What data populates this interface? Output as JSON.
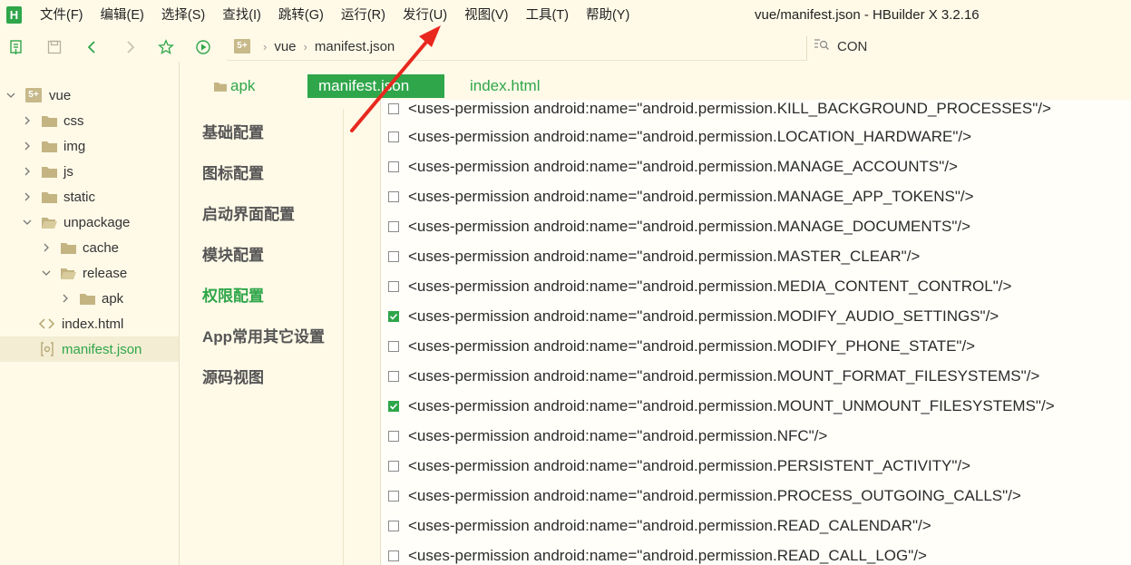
{
  "app": {
    "logo": "H",
    "window_title": "vue/manifest.json - HBuilder X 3.2.16"
  },
  "menu": [
    "文件(F)",
    "编辑(E)",
    "选择(S)",
    "查找(I)",
    "跳转(G)",
    "运行(R)",
    "发行(U)",
    "视图(V)",
    "工具(T)",
    "帮助(Y)"
  ],
  "toolbar": {
    "icons": [
      "new-file-icon",
      "save-icon",
      "back-icon",
      "forward-icon",
      "star-icon",
      "run-icon"
    ],
    "breadcrumb": {
      "logo": "5+",
      "items": [
        "vue",
        "manifest.json"
      ]
    },
    "search": {
      "value": "CON"
    }
  },
  "sidebar": {
    "tree": [
      {
        "label": "vue",
        "depth": 0,
        "expanded": true,
        "type": "project"
      },
      {
        "label": "css",
        "depth": 1,
        "expanded": false,
        "type": "folder"
      },
      {
        "label": "img",
        "depth": 1,
        "expanded": false,
        "type": "folder"
      },
      {
        "label": "js",
        "depth": 1,
        "expanded": false,
        "type": "folder"
      },
      {
        "label": "static",
        "depth": 1,
        "expanded": false,
        "type": "folder"
      },
      {
        "label": "unpackage",
        "depth": 1,
        "expanded": true,
        "type": "folder-open"
      },
      {
        "label": "cache",
        "depth": 2,
        "expanded": false,
        "type": "folder"
      },
      {
        "label": "release",
        "depth": 2,
        "expanded": true,
        "type": "folder-open"
      },
      {
        "label": "apk",
        "depth": 3,
        "expanded": false,
        "type": "folder"
      },
      {
        "label": "index.html",
        "depth": 1,
        "type": "html-file"
      },
      {
        "label": "manifest.json",
        "depth": 1,
        "type": "json-file",
        "selected": true
      }
    ]
  },
  "tabs": [
    "apk",
    "manifest.json",
    "index.html"
  ],
  "config_nav": [
    {
      "label": "基础配置",
      "active": false
    },
    {
      "label": "图标配置",
      "active": false
    },
    {
      "label": "启动界面配置",
      "active": false
    },
    {
      "label": "模块配置",
      "active": false
    },
    {
      "label": "权限配置",
      "active": true
    },
    {
      "label": "App常用其它设置",
      "active": false
    },
    {
      "label": "源码视图",
      "active": false
    }
  ],
  "permissions": [
    {
      "text": "<uses-permission android:name=\"android.permission.KILL_BACKGROUND_PROCESSES\"/>",
      "checked": false
    },
    {
      "text": "<uses-permission android:name=\"android.permission.LOCATION_HARDWARE\"/>",
      "checked": false
    },
    {
      "text": "<uses-permission android:name=\"android.permission.MANAGE_ACCOUNTS\"/>",
      "checked": false
    },
    {
      "text": "<uses-permission android:name=\"android.permission.MANAGE_APP_TOKENS\"/>",
      "checked": false
    },
    {
      "text": "<uses-permission android:name=\"android.permission.MANAGE_DOCUMENTS\"/>",
      "checked": false
    },
    {
      "text": "<uses-permission android:name=\"android.permission.MASTER_CLEAR\"/>",
      "checked": false
    },
    {
      "text": "<uses-permission android:name=\"android.permission.MEDIA_CONTENT_CONTROL\"/>",
      "checked": false
    },
    {
      "text": "<uses-permission android:name=\"android.permission.MODIFY_AUDIO_SETTINGS\"/>",
      "checked": true
    },
    {
      "text": "<uses-permission android:name=\"android.permission.MODIFY_PHONE_STATE\"/>",
      "checked": false
    },
    {
      "text": "<uses-permission android:name=\"android.permission.MOUNT_FORMAT_FILESYSTEMS\"/>",
      "checked": false
    },
    {
      "text": "<uses-permission android:name=\"android.permission.MOUNT_UNMOUNT_FILESYSTEMS\"/>",
      "checked": true
    },
    {
      "text": "<uses-permission android:name=\"android.permission.NFC\"/>",
      "checked": false
    },
    {
      "text": "<uses-permission android:name=\"android.permission.PERSISTENT_ACTIVITY\"/>",
      "checked": false
    },
    {
      "text": "<uses-permission android:name=\"android.permission.PROCESS_OUTGOING_CALLS\"/>",
      "checked": false
    },
    {
      "text": "<uses-permission android:name=\"android.permission.READ_CALENDAR\"/>",
      "checked": false
    },
    {
      "text": "<uses-permission android:name=\"android.permission.READ_CALL_LOG\"/>",
      "checked": false
    }
  ],
  "colors": {
    "accent": "#2fa64a",
    "background": "#fffae8",
    "annotation_arrow": "#e8281e"
  }
}
